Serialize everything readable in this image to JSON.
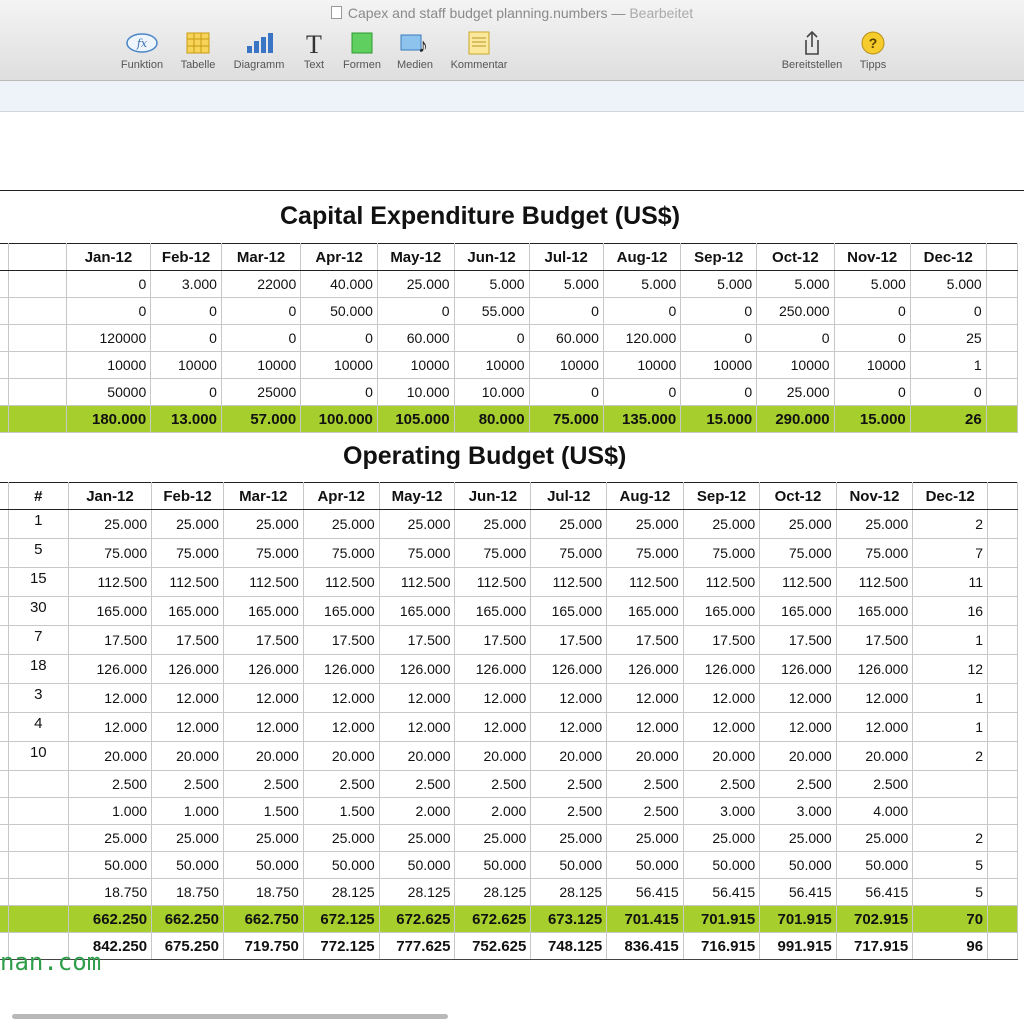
{
  "window": {
    "title": "Capex and staff budget planning.numbers",
    "separator": " — ",
    "status": "Bearbeitet"
  },
  "toolbar": [
    {
      "name": "function",
      "label": "Funktion",
      "icon": "function-icon"
    },
    {
      "name": "table",
      "label": "Tabelle",
      "icon": "table-icon"
    },
    {
      "name": "chart",
      "label": "Diagramm",
      "icon": "chart-icon"
    },
    {
      "name": "text",
      "label": "Text",
      "icon": "text-icon"
    },
    {
      "name": "shapes",
      "label": "Formen",
      "icon": "shape-icon"
    },
    {
      "name": "media",
      "label": "Medien",
      "icon": "media-icon"
    },
    {
      "name": "comment",
      "label": "Kommentar",
      "icon": "comment-icon"
    },
    {
      "name": "share",
      "label": "Bereitstellen",
      "icon": "share-icon"
    },
    {
      "name": "tips",
      "label": "Tipps",
      "icon": "help-icon"
    }
  ],
  "colors": {
    "total_row": "#a6cf2e",
    "watermark": "#2e9e4a"
  },
  "months": [
    "Jan-12",
    "Feb-12",
    "Mar-12",
    "Apr-12",
    "May-12",
    "Jun-12",
    "Jul-12",
    "Aug-12",
    "Sep-12",
    "Oct-12",
    "Nov-12",
    "Dec-12"
  ],
  "capex": {
    "title": "Capital Expenditure Budget (US$)",
    "rows": [
      [
        "0",
        "3.000",
        "22000",
        "40.000",
        "25.000",
        "5.000",
        "5.000",
        "5.000",
        "5.000",
        "5.000",
        "5.000",
        "5.000"
      ],
      [
        "0",
        "0",
        "0",
        "50.000",
        "0",
        "55.000",
        "0",
        "0",
        "0",
        "250.000",
        "0",
        "0"
      ],
      [
        "120000",
        "0",
        "0",
        "0",
        "60.000",
        "0",
        "60.000",
        "120.000",
        "0",
        "0",
        "0",
        "25"
      ],
      [
        "10000",
        "10000",
        "10000",
        "10000",
        "10000",
        "10000",
        "10000",
        "10000",
        "10000",
        "10000",
        "10000",
        "1"
      ],
      [
        "50000",
        "0",
        "25000",
        "0",
        "10.000",
        "10.000",
        "0",
        "0",
        "0",
        "25.000",
        "0",
        "0"
      ]
    ],
    "total": [
      "180.000",
      "13.000",
      "57.000",
      "100.000",
      "105.000",
      "80.000",
      "75.000",
      "135.000",
      "15.000",
      "290.000",
      "15.000",
      "26"
    ]
  },
  "opex": {
    "title": "Operating Budget (US$)",
    "count_header": "#",
    "staff_rows": [
      {
        "count": "1",
        "values": [
          "25.000",
          "25.000",
          "25.000",
          "25.000",
          "25.000",
          "25.000",
          "25.000",
          "25.000",
          "25.000",
          "25.000",
          "25.000",
          "2"
        ]
      },
      {
        "count": "5",
        "values": [
          "75.000",
          "75.000",
          "75.000",
          "75.000",
          "75.000",
          "75.000",
          "75.000",
          "75.000",
          "75.000",
          "75.000",
          "75.000",
          "7"
        ]
      },
      {
        "count": "15",
        "values": [
          "112.500",
          "112.500",
          "112.500",
          "112.500",
          "112.500",
          "112.500",
          "112.500",
          "112.500",
          "112.500",
          "112.500",
          "112.500",
          "11"
        ]
      },
      {
        "count": "30",
        "values": [
          "165.000",
          "165.000",
          "165.000",
          "165.000",
          "165.000",
          "165.000",
          "165.000",
          "165.000",
          "165.000",
          "165.000",
          "165.000",
          "16"
        ]
      },
      {
        "count": "7",
        "values": [
          "17.500",
          "17.500",
          "17.500",
          "17.500",
          "17.500",
          "17.500",
          "17.500",
          "17.500",
          "17.500",
          "17.500",
          "17.500",
          "1"
        ]
      },
      {
        "count": "18",
        "values": [
          "126.000",
          "126.000",
          "126.000",
          "126.000",
          "126.000",
          "126.000",
          "126.000",
          "126.000",
          "126.000",
          "126.000",
          "126.000",
          "12"
        ]
      },
      {
        "count": "3",
        "values": [
          "12.000",
          "12.000",
          "12.000",
          "12.000",
          "12.000",
          "12.000",
          "12.000",
          "12.000",
          "12.000",
          "12.000",
          "12.000",
          "1"
        ]
      },
      {
        "count": "4",
        "values": [
          "12.000",
          "12.000",
          "12.000",
          "12.000",
          "12.000",
          "12.000",
          "12.000",
          "12.000",
          "12.000",
          "12.000",
          "12.000",
          "1"
        ]
      },
      {
        "count": "10",
        "values": [
          "20.000",
          "20.000",
          "20.000",
          "20.000",
          "20.000",
          "20.000",
          "20.000",
          "20.000",
          "20.000",
          "20.000",
          "20.000",
          "2"
        ]
      }
    ],
    "other_rows": [
      [
        "2.500",
        "2.500",
        "2.500",
        "2.500",
        "2.500",
        "2.500",
        "2.500",
        "2.500",
        "2.500",
        "2.500",
        "2.500",
        ""
      ],
      [
        "1.000",
        "1.000",
        "1.500",
        "1.500",
        "2.000",
        "2.000",
        "2.500",
        "2.500",
        "3.000",
        "3.000",
        "4.000",
        ""
      ],
      [
        "25.000",
        "25.000",
        "25.000",
        "25.000",
        "25.000",
        "25.000",
        "25.000",
        "25.000",
        "25.000",
        "25.000",
        "25.000",
        "2"
      ],
      [
        "50.000",
        "50.000",
        "50.000",
        "50.000",
        "50.000",
        "50.000",
        "50.000",
        "50.000",
        "50.000",
        "50.000",
        "50.000",
        "5"
      ],
      [
        "18.750",
        "18.750",
        "18.750",
        "28.125",
        "28.125",
        "28.125",
        "28.125",
        "56.415",
        "56.415",
        "56.415",
        "56.415",
        "5"
      ]
    ],
    "total": [
      "662.250",
      "662.250",
      "662.750",
      "672.125",
      "672.625",
      "672.625",
      "673.125",
      "701.415",
      "701.915",
      "701.915",
      "702.915",
      "70"
    ],
    "grand_total": [
      "842.250",
      "675.250",
      "719.750",
      "772.125",
      "777.625",
      "752.625",
      "748.125",
      "836.415",
      "716.915",
      "991.915",
      "717.915",
      "96"
    ]
  },
  "watermark": "nan.com"
}
